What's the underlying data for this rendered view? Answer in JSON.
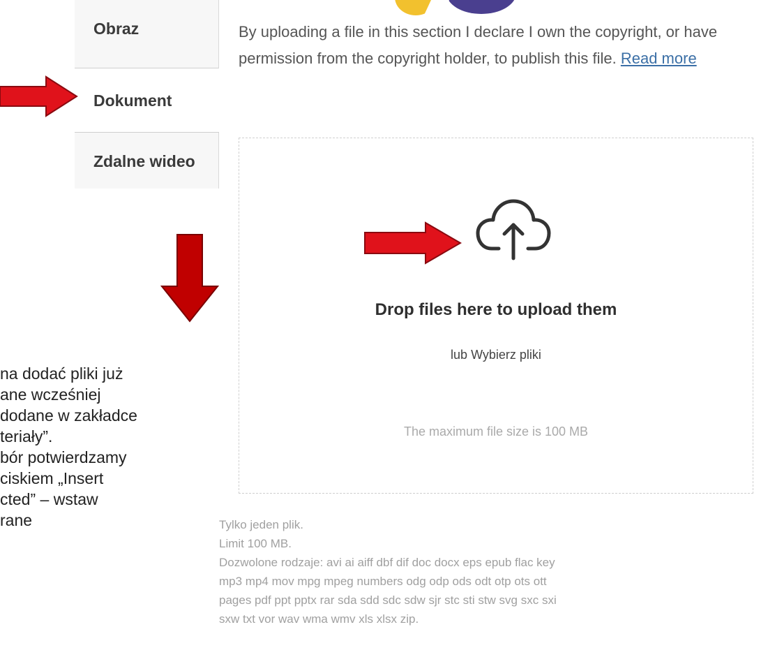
{
  "tabs": [
    {
      "label": "Obraz"
    },
    {
      "label": "Dokument"
    },
    {
      "label": "Zdalne wideo"
    }
  ],
  "upload_notice": {
    "text": "By uploading a file in this section I declare I own the copyright, or have permission from the copyright holder, to publish this file.",
    "link": "Read more"
  },
  "dropzone": {
    "title": "Drop files here to upload them",
    "choose": "lub Wybierz pliki",
    "max_size": "The maximum file size is 100 MB",
    "icon": "cloud-upload-icon"
  },
  "hints": {
    "line1": "Tylko jeden plik.",
    "line2": "Limit 100 MB.",
    "line3": "Dozwolone rodzaje: avi ai aiff dbf dif doc docx eps epub flac key",
    "line4": "mp3 mp4 mov mpg mpeg numbers odg odp ods odt otp ots ott",
    "line5": "pages pdf ppt pptx rar sda sdd sdc sdw sjr stc sti stw svg sxc sxi",
    "line6": "sxw txt vor wav wma wmv xls xlsx zip."
  },
  "caption": {
    "line1": "na dodać pliki już",
    "line2": "ane wcześniej",
    "line3": "dodane w zakładce",
    "line4": "teriały”.",
    "line5": "bór potwierdzamy",
    "line6": "ciskiem „Insert",
    "line7": "cted” – wstaw",
    "line8": "rane"
  },
  "colors": {
    "arrow_fill": "#e0121b",
    "arrow_stroke": "#8a0a10",
    "down_arrow_fill": "#c00000",
    "link": "#3b6fa6"
  }
}
